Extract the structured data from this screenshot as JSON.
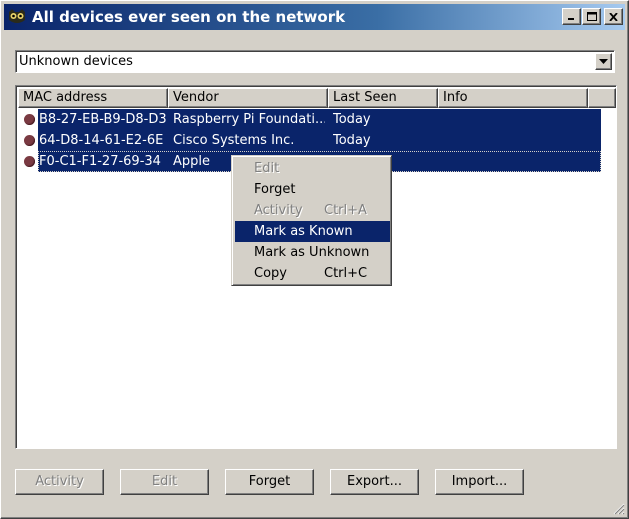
{
  "window": {
    "title": "All devices ever seen on the network",
    "controls": {
      "minimize": "minimize",
      "maximize": "maximize",
      "close": "close"
    }
  },
  "filter": {
    "selected": "Unknown devices"
  },
  "list": {
    "columns": [
      "MAC address",
      "Vendor",
      "Last Seen",
      "Info"
    ],
    "rows": [
      {
        "mac": "B8-27-EB-B9-D8-D3",
        "vendor": "Raspberry Pi Foundati...",
        "last_seen": "Today",
        "info": ""
      },
      {
        "mac": "64-D8-14-61-E2-6E",
        "vendor": "Cisco Systems Inc.",
        "last_seen": "Today",
        "info": ""
      },
      {
        "mac": "F0-C1-F1-27-69-34",
        "vendor": "Apple",
        "last_seen": "",
        "info": ""
      }
    ],
    "status_color": "#7a3a42"
  },
  "context_menu": {
    "items": [
      {
        "label": "Edit",
        "shortcut": "",
        "enabled": false
      },
      {
        "label": "Forget",
        "shortcut": "",
        "enabled": true
      },
      {
        "label": "Activity",
        "shortcut": "Ctrl+A",
        "enabled": false
      },
      {
        "label": "Mark as Known",
        "shortcut": "",
        "enabled": true,
        "highlighted": true
      },
      {
        "label": "Mark as Unknown",
        "shortcut": "",
        "enabled": true
      },
      {
        "label": "Copy",
        "shortcut": "Ctrl+C",
        "enabled": true
      }
    ]
  },
  "buttons": {
    "activity": "Activity",
    "edit": "Edit",
    "forget": "Forget",
    "export": "Export...",
    "import": "Import..."
  },
  "colors": {
    "selection": "#0a246a",
    "titlebar_start": "#0a246a",
    "face": "#d4d0c8"
  }
}
